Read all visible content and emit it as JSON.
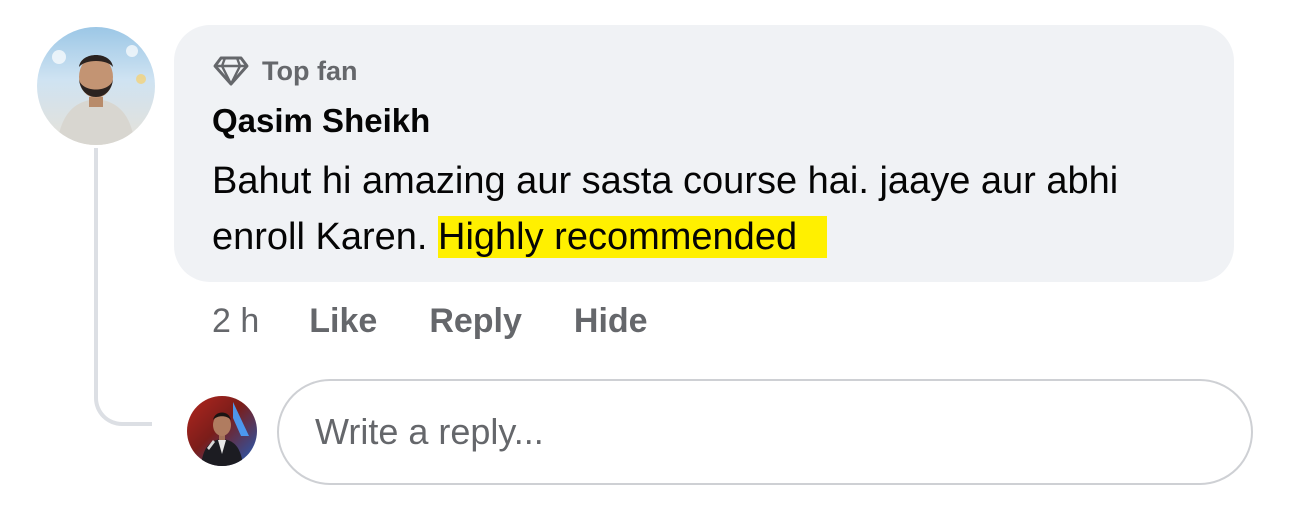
{
  "comment": {
    "badge_label": "Top fan",
    "badge_icon": "diamond-icon",
    "author": "Qasim Sheikh",
    "text_plain": "Bahut hi amazing aur sasta course hai. jaaye aur abhi enroll Karen.",
    "text_highlight": "Highly recommended",
    "highlight_color": "#fff000"
  },
  "actions": {
    "time": "2 h",
    "like": "Like",
    "reply": "Reply",
    "hide": "Hide"
  },
  "reply_box": {
    "placeholder": "Write a reply..."
  },
  "colors": {
    "bubble_bg": "#f0f2f5",
    "secondary_text": "#65676b",
    "primary_text": "#050505",
    "thread_line": "#dcdfe4"
  }
}
